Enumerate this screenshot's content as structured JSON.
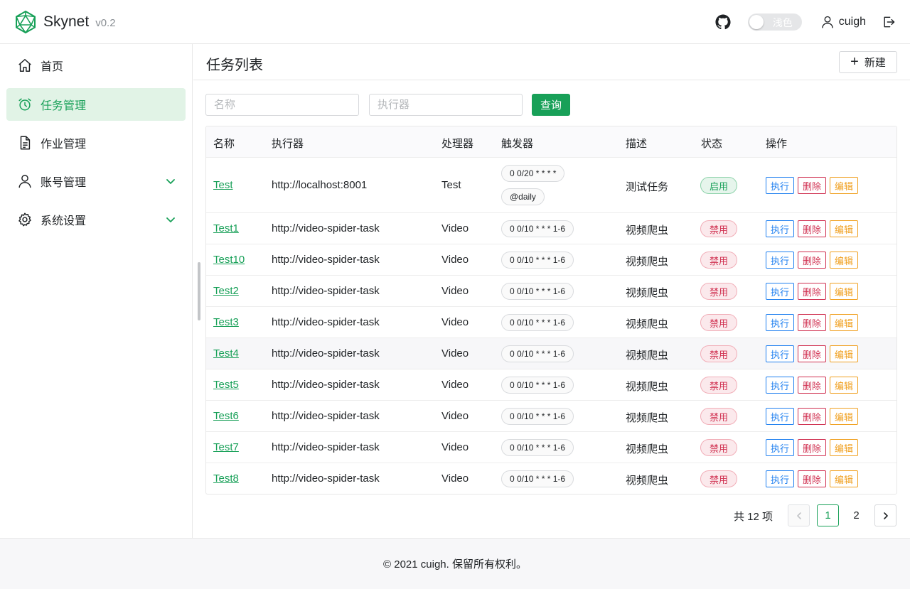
{
  "app": {
    "name": "Skynet",
    "version": "v0.2"
  },
  "header": {
    "theme_label": "浅色",
    "username": "cuigh"
  },
  "sidebar": {
    "items": [
      {
        "label": "首页"
      },
      {
        "label": "任务管理"
      },
      {
        "label": "作业管理"
      },
      {
        "label": "账号管理"
      },
      {
        "label": "系统设置"
      }
    ]
  },
  "page": {
    "title": "任务列表",
    "new_label": "新建"
  },
  "search": {
    "name_placeholder": "名称",
    "executor_placeholder": "执行器",
    "button_label": "查询"
  },
  "table": {
    "headers": [
      "名称",
      "执行器",
      "处理器",
      "触发器",
      "描述",
      "状态",
      "操作"
    ],
    "actions": {
      "run": "执行",
      "delete": "删除",
      "edit": "编辑"
    },
    "rows": [
      {
        "name": "Test",
        "executor": "http://localhost:8001",
        "handler": "Test",
        "triggers": [
          "0 0/20 * * * *",
          "@daily"
        ],
        "desc": "测试任务",
        "status": "启用"
      },
      {
        "name": "Test1",
        "executor": "http://video-spider-task",
        "handler": "Video",
        "triggers": [
          "0 0/10 * * * 1-6"
        ],
        "desc": "视频爬虫",
        "status": "禁用"
      },
      {
        "name": "Test10",
        "executor": "http://video-spider-task",
        "handler": "Video",
        "triggers": [
          "0 0/10 * * * 1-6"
        ],
        "desc": "视频爬虫",
        "status": "禁用"
      },
      {
        "name": "Test2",
        "executor": "http://video-spider-task",
        "handler": "Video",
        "triggers": [
          "0 0/10 * * * 1-6"
        ],
        "desc": "视频爬虫",
        "status": "禁用"
      },
      {
        "name": "Test3",
        "executor": "http://video-spider-task",
        "handler": "Video",
        "triggers": [
          "0 0/10 * * * 1-6"
        ],
        "desc": "视频爬虫",
        "status": "禁用"
      },
      {
        "name": "Test4",
        "executor": "http://video-spider-task",
        "handler": "Video",
        "triggers": [
          "0 0/10 * * * 1-6"
        ],
        "desc": "视频爬虫",
        "status": "禁用"
      },
      {
        "name": "Test5",
        "executor": "http://video-spider-task",
        "handler": "Video",
        "triggers": [
          "0 0/10 * * * 1-6"
        ],
        "desc": "视频爬虫",
        "status": "禁用"
      },
      {
        "name": "Test6",
        "executor": "http://video-spider-task",
        "handler": "Video",
        "triggers": [
          "0 0/10 * * * 1-6"
        ],
        "desc": "视频爬虫",
        "status": "禁用"
      },
      {
        "name": "Test7",
        "executor": "http://video-spider-task",
        "handler": "Video",
        "triggers": [
          "0 0/10 * * * 1-6"
        ],
        "desc": "视频爬虫",
        "status": "禁用"
      },
      {
        "name": "Test8",
        "executor": "http://video-spider-task",
        "handler": "Video",
        "triggers": [
          "0 0/10 * * * 1-6"
        ],
        "desc": "视频爬虫",
        "status": "禁用"
      }
    ]
  },
  "pagination": {
    "total_label": "共 12 项",
    "pages": [
      "1",
      "2"
    ],
    "current": "1"
  },
  "footer": {
    "text": "© 2021 cuigh. 保留所有权利。"
  },
  "colors": {
    "primary": "#18a058",
    "danger": "#d03050",
    "info": "#2080f0",
    "warning": "#f0a020"
  }
}
